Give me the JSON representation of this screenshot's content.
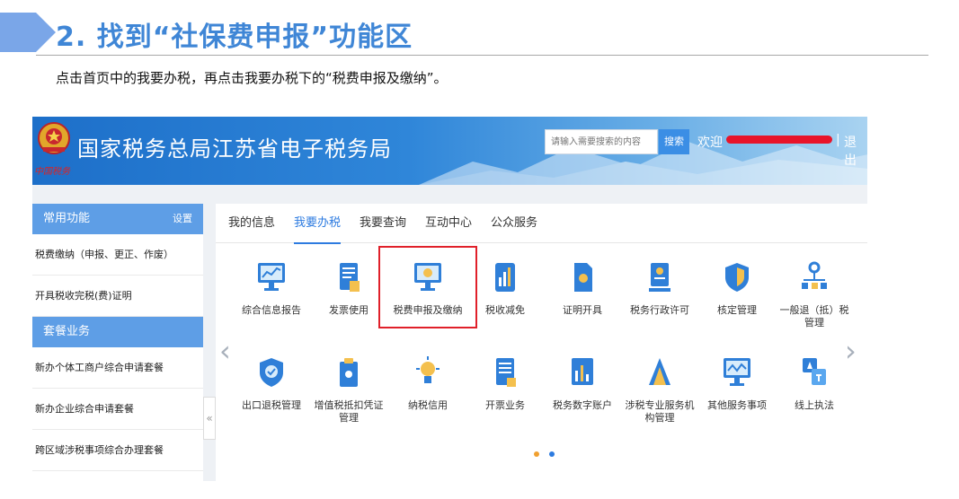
{
  "slide": {
    "title": "2. 找到“社保费申报”功能区",
    "instruction": "点击首页中的我要办税，再点击我要办税下的“税费申报及缴纳”。"
  },
  "site": {
    "title": "国家税务总局江苏省电子税务局",
    "tagline": "中国税务",
    "search_placeholder": "请输入需要搜索的内容",
    "search_button": "搜索",
    "welcome": "欢迎",
    "separator": "|",
    "logout": "退出"
  },
  "sidebar": {
    "common_title": "常用功能",
    "settings": "设置",
    "common_items": [
      "税费缴纳（申报、更正、作废）",
      "开具税收完税(费)证明"
    ],
    "package_title": "套餐业务",
    "package_items": [
      "新办个体工商户综合申请套餐",
      "新办企业综合申请套餐",
      "跨区域涉税事项综合办理套餐"
    ],
    "collapse": "«"
  },
  "tabs": [
    "我的信息",
    "我要办税",
    "我要查询",
    "互动中心",
    "公众服务"
  ],
  "active_tab": "我要办税",
  "tiles_row1": [
    "综合信息报告",
    "发票使用",
    "税费申报及缴纳",
    "税收减免",
    "证明开具",
    "税务行政许可",
    "核定管理",
    "一般退（抵）税管理"
  ],
  "tiles_row2": [
    "出口退税管理",
    "增值税抵扣凭证管理",
    "纳税信用",
    "开票业务",
    "税务数字账户",
    "涉税专业服务机构管理",
    "其他服务事项",
    "线上执法"
  ],
  "nav": {
    "prev": "‹",
    "next": "›"
  },
  "colors": {
    "accent": "#2d7be0",
    "highlight": "#e0202a",
    "dot_active": "#f0a030",
    "dot": "#2d7be0"
  }
}
